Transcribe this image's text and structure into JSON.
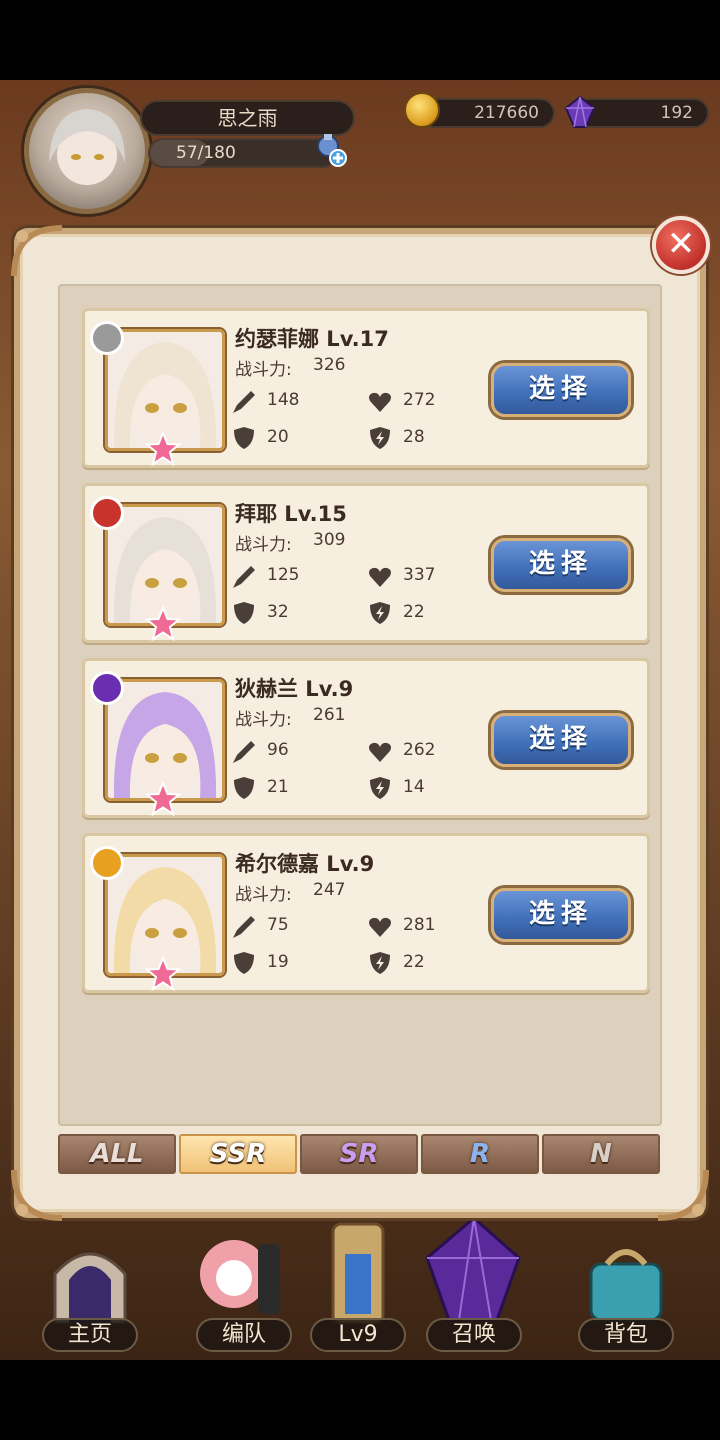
{
  "player": {
    "name": "思之雨",
    "stamina": "57/180",
    "stamina_fraction": 0.317,
    "gold": "217660",
    "gems": "192"
  },
  "modal": {
    "close_label": "✕",
    "heroes": [
      {
        "name": "约瑟菲娜 Lv.17",
        "power_label": "战斗力:",
        "power": "326",
        "attack": "148",
        "hp": "272",
        "defense": "20",
        "speed": "28",
        "select_label": "选择",
        "element_color": "#9a9a9a",
        "hair": "#efe4d2"
      },
      {
        "name": "拜耶 Lv.15",
        "power_label": "战斗力:",
        "power": "309",
        "attack": "125",
        "hp": "337",
        "defense": "32",
        "speed": "22",
        "select_label": "选择",
        "element_color": "#c8342c",
        "hair": "#e6e0d8"
      },
      {
        "name": "狄赫兰 Lv.9",
        "power_label": "战斗力:",
        "power": "261",
        "attack": "96",
        "hp": "262",
        "defense": "21",
        "speed": "14",
        "select_label": "选择",
        "element_color": "#6a2fb0",
        "hair": "#c6a6e6"
      },
      {
        "name": "希尔德嘉 Lv.9",
        "power_label": "战斗力:",
        "power": "247",
        "attack": "75",
        "hp": "281",
        "defense": "19",
        "speed": "22",
        "select_label": "选择",
        "element_color": "#e8a020",
        "hair": "#f3dba8"
      }
    ],
    "tabs": [
      {
        "label": "ALL",
        "color": "#e8e0d8"
      },
      {
        "label": "SSR",
        "color": "#fff3d8"
      },
      {
        "label": "SR",
        "color": "#c79ef0"
      },
      {
        "label": "R",
        "color": "#8ab4f0"
      },
      {
        "label": "N",
        "color": "#d8d0c8"
      }
    ],
    "active_tab": "SSR"
  },
  "bottom_nav": [
    {
      "label": "主页",
      "icon": "gate-icon"
    },
    {
      "label": "编队",
      "icon": "team-icon"
    },
    {
      "label": "Lv9",
      "icon": "tower-icon"
    },
    {
      "label": "召唤",
      "icon": "crystal-icon"
    },
    {
      "label": "背包",
      "icon": "bag-icon"
    }
  ]
}
